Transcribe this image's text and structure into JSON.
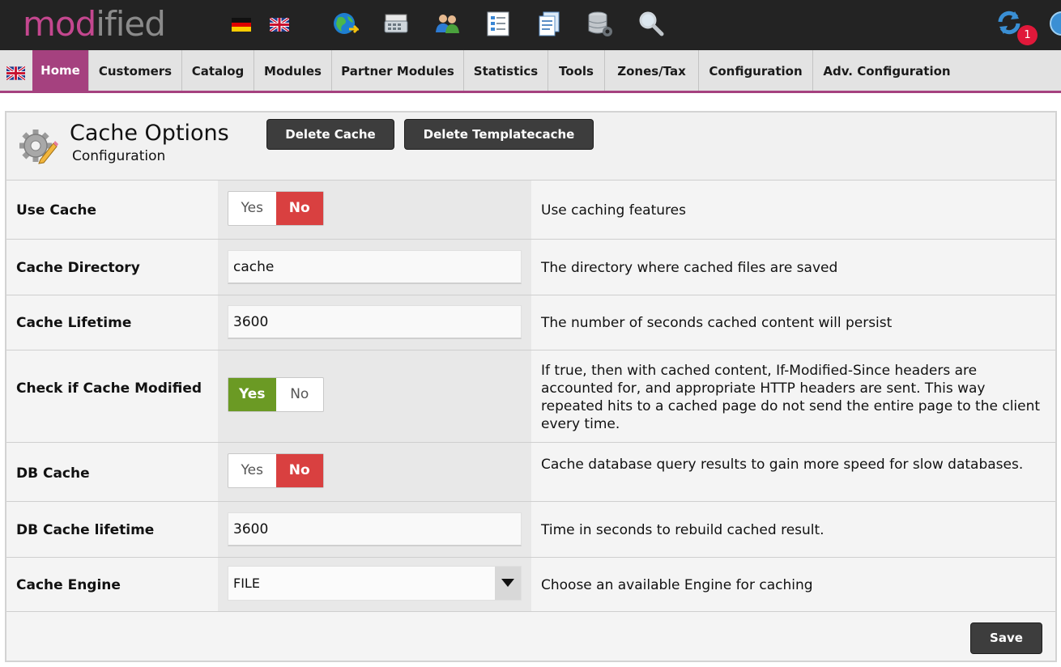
{
  "brand": {
    "part1": "mod",
    "part2": "ified",
    "color_primary": "#c4478f",
    "color_secondary": "#8a8a8a"
  },
  "header": {
    "languages": [
      "german-flag-icon",
      "english-flag-icon"
    ],
    "toolbar_icons": [
      "globe-icon",
      "cash-register-icon",
      "users-icon",
      "list-icon",
      "documents-icon",
      "database-settings-icon",
      "search-icon"
    ],
    "notification_count": "1"
  },
  "nav": {
    "items": [
      "Home",
      "Customers",
      "Catalog",
      "Modules",
      "Partner Modules",
      "Statistics",
      "Tools",
      "Zones/Tax",
      "Configuration",
      "Adv. Configuration"
    ],
    "active": "Home",
    "accent": "#a5417f"
  },
  "page": {
    "title": "Cache Options",
    "subtitle": "Configuration",
    "delete_cache": "Delete Cache",
    "delete_templatecache": "Delete Templatecache",
    "save": "Save"
  },
  "settings": [
    {
      "label": "Use Cache",
      "type": "toggle",
      "yes": "Yes",
      "no": "No",
      "value": "No",
      "description": "Use caching features"
    },
    {
      "label": "Cache Directory",
      "type": "text",
      "value": "cache",
      "description": "The directory where cached files are saved"
    },
    {
      "label": "Cache Lifetime",
      "type": "text",
      "value": "3600",
      "description": "The number of seconds cached content will persist"
    },
    {
      "label": "Check if Cache Modified",
      "type": "toggle",
      "yes": "Yes",
      "no": "No",
      "value": "Yes",
      "description": "If true, then with cached content, If-Modified-Since headers are accounted for, and appropriate HTTP headers are sent. This way repeated hits to a cached page do not send the entire page to the client every time."
    },
    {
      "label": "DB Cache",
      "type": "toggle",
      "yes": "Yes",
      "no": "No",
      "value": "No",
      "description": "Cache database query results to gain more speed for slow databases."
    },
    {
      "label": "DB Cache lifetime",
      "type": "text",
      "value": "3600",
      "description": "Time in seconds to rebuild cached result."
    },
    {
      "label": "Cache Engine",
      "type": "select",
      "value": "FILE",
      "description": "Choose an available Engine for caching"
    }
  ],
  "colors": {
    "toggle_yes": "#6b9a24",
    "toggle_no": "#d94040",
    "button_dark": "#3d3d3d",
    "badge": "#e0183a"
  }
}
